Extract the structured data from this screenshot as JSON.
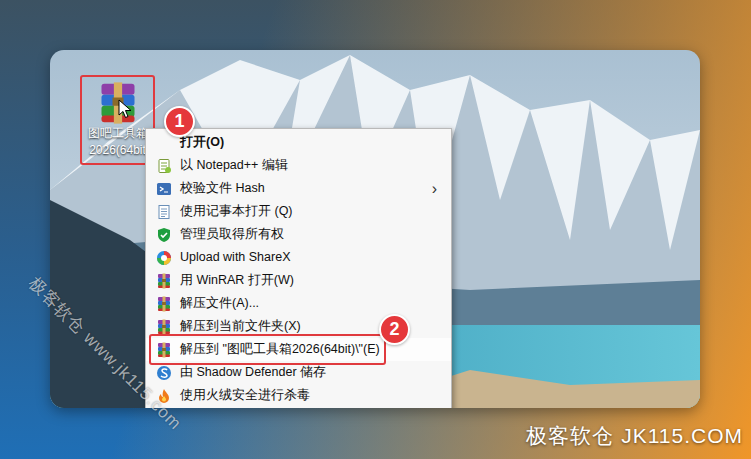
{
  "desktop": {
    "icon": {
      "label_lines": [
        "图吧工具箱",
        "2026(64bit"
      ],
      "selected": true
    }
  },
  "context_menu": {
    "items": [
      {
        "label": "打开(O)",
        "kind": "plain",
        "default": true,
        "selected": false
      },
      {
        "label": "以 Notepad++ 编辑",
        "kind": "notepadpp",
        "default": false,
        "selected": false
      },
      {
        "label": "校验文件 Hash",
        "kind": "hash",
        "default": false,
        "selected": false,
        "arrow": "›"
      },
      {
        "label": "使用记事本打开 (Q)",
        "kind": "notepad",
        "default": false,
        "selected": false
      },
      {
        "label": "管理员取得所有权",
        "kind": "shield",
        "default": false,
        "selected": false
      },
      {
        "label": "Upload with ShareX",
        "kind": "sharex",
        "default": false,
        "selected": false
      },
      {
        "label": "用 WinRAR 打开(W)",
        "kind": "winrar",
        "default": false,
        "selected": false
      },
      {
        "label": "解压文件(A)...",
        "kind": "winrar",
        "default": false,
        "selected": false
      },
      {
        "label": "解压到当前文件夹(X)",
        "kind": "winrar",
        "default": false,
        "selected": false
      },
      {
        "label": "解压到 \"图吧工具箱2026(64bit)\\\"(E)",
        "kind": "winrar",
        "default": false,
        "selected": true
      },
      {
        "label": "由 Shadow Defender 储存",
        "kind": "shadow",
        "default": false,
        "selected": false
      },
      {
        "label": "使用火绒安全进行杀毒",
        "kind": "huorong",
        "default": false,
        "selected": false
      }
    ]
  },
  "callouts": [
    {
      "number": "1"
    },
    {
      "number": "2"
    }
  ],
  "watermarks": [
    "极客软仓 www.jk115.com",
    "极客软仓 JK115.COM"
  ]
}
